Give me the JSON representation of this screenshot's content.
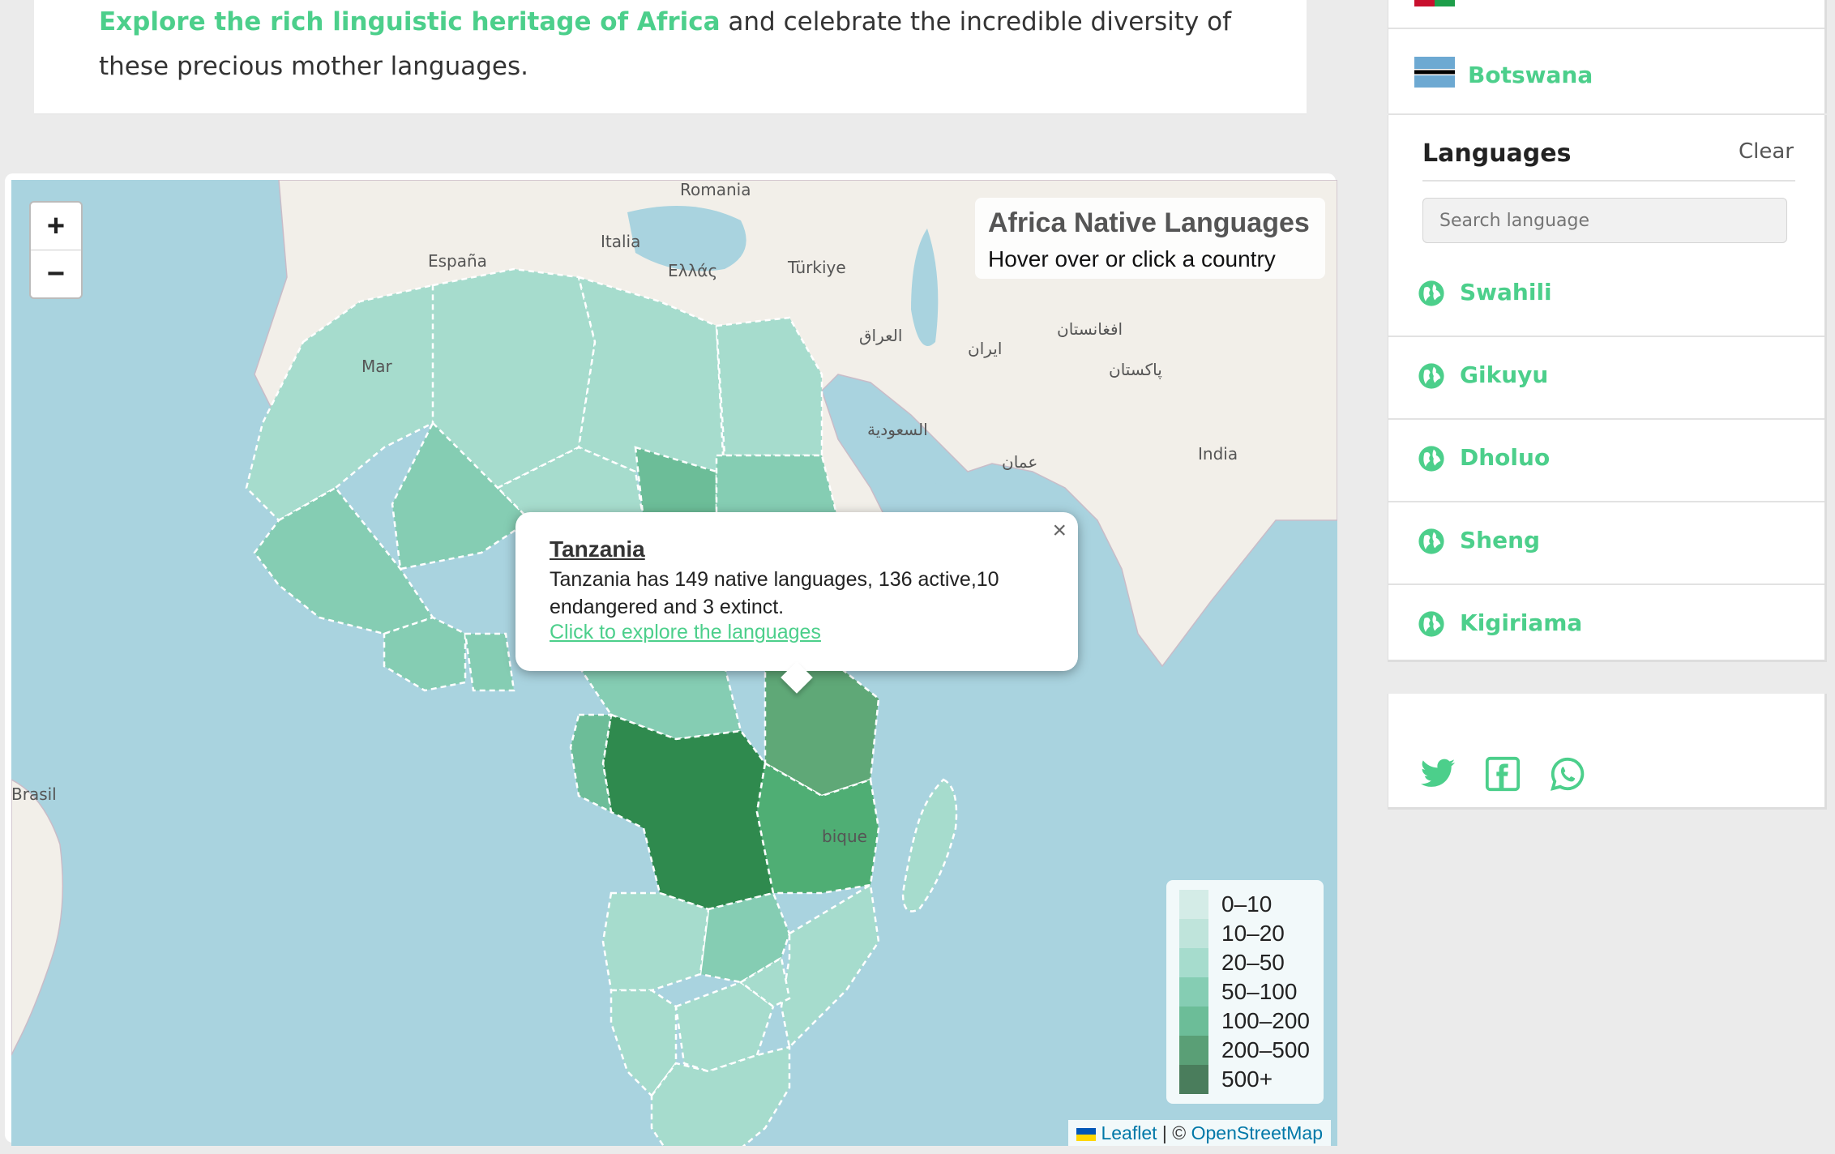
{
  "intro": {
    "highlight": "Explore the rich linguistic heritage of Africa",
    "rest_line1": " and celebrate the incredible diversity of",
    "line2": "these precious mother languages."
  },
  "map": {
    "zoom_in": "+",
    "zoom_out": "−",
    "info_title": "Africa Native Languages",
    "info_subtitle": "Hover over or click a country",
    "labels": {
      "romania": "Romania",
      "espana": "España",
      "italia": "Italia",
      "ellas": "Ελλάς",
      "turkiye": "Türkiye",
      "iraq": "العراق",
      "iran": "ایران",
      "afghanistan": "افغانستان",
      "pakistan": "پاکستان",
      "saudi": "السعودية",
      "oman": "عمان",
      "india": "India",
      "brasil": "Brasil",
      "morocco": "Mar",
      "mozambique": "bique"
    },
    "popup": {
      "title": "Tanzania",
      "body": "Tanzania has 149 native languages, 136 active,10 endangered and 3 extinct.",
      "link": "Click to explore the languages",
      "close": "×"
    },
    "legend": [
      {
        "label": "0–10",
        "color": "#d4ece7"
      },
      {
        "label": "10–20",
        "color": "#bfe4db"
      },
      {
        "label": "20–50",
        "color": "#a6dccd"
      },
      {
        "label": "50–100",
        "color": "#85cdb3"
      },
      {
        "label": "100–200",
        "color": "#6cbd98"
      },
      {
        "label": "200–500",
        "color": "#5a9f76"
      },
      {
        "label": "500+",
        "color": "#4a7d5c"
      }
    ],
    "attribution": {
      "leaflet": "Leaflet",
      "separator": " | © ",
      "osm": "OpenStreetMap"
    }
  },
  "sidebar": {
    "countries": [
      {
        "name": "Botswana",
        "flag": "botswana-flag-icon"
      }
    ],
    "languages_heading": "Languages",
    "clear_label": "Clear",
    "search_placeholder": "Search language",
    "languages": [
      "Swahili",
      "Gikuyu",
      "Dholuo",
      "Sheng",
      "Kigiriama"
    ],
    "share_icons": [
      "twitter-icon",
      "facebook-icon",
      "whatsapp-icon"
    ]
  },
  "colors": {
    "accent": "#4ccf8b",
    "water": "#a9d3df",
    "land": "#f2efe9"
  }
}
